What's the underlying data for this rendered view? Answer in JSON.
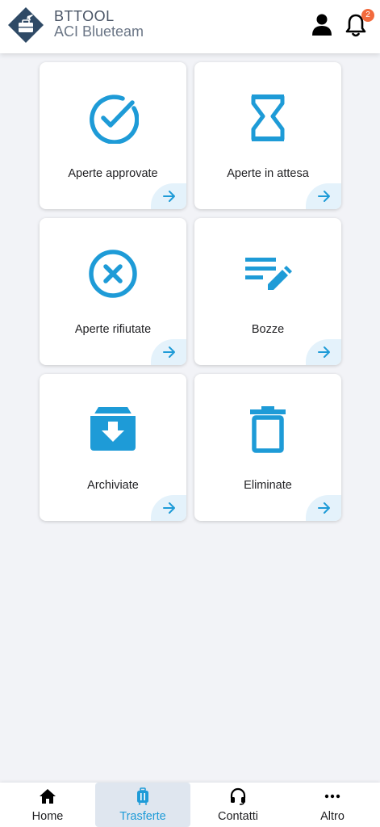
{
  "header": {
    "title": "BTTOOL",
    "subtitle": "ACI Blueteam",
    "notifications_count": "2",
    "user_icon": "user-icon",
    "bell_icon": "bell-icon"
  },
  "colors": {
    "accent": "#1e9bd7",
    "logo": "#2f4a66",
    "badge": "#f26a3d",
    "active_nav_bg": "#dfe6ef"
  },
  "cards": [
    {
      "label": "Aperte approvate",
      "icon": "check-circle-icon"
    },
    {
      "label": "Aperte in attesa",
      "icon": "hourglass-icon"
    },
    {
      "label": "Aperte rifiutate",
      "icon": "x-circle-icon"
    },
    {
      "label": "Bozze",
      "icon": "edit-note-icon"
    },
    {
      "label": "Archiviate",
      "icon": "archive-icon"
    },
    {
      "label": "Eliminate",
      "icon": "trash-icon"
    }
  ],
  "bottom_nav": [
    {
      "label": "Home",
      "icon": "home-icon",
      "active": false
    },
    {
      "label": "Trasferte",
      "icon": "suitcase-icon",
      "active": true
    },
    {
      "label": "Contatti",
      "icon": "headset-icon",
      "active": false
    },
    {
      "label": "Altro",
      "icon": "more-icon",
      "active": false
    }
  ]
}
